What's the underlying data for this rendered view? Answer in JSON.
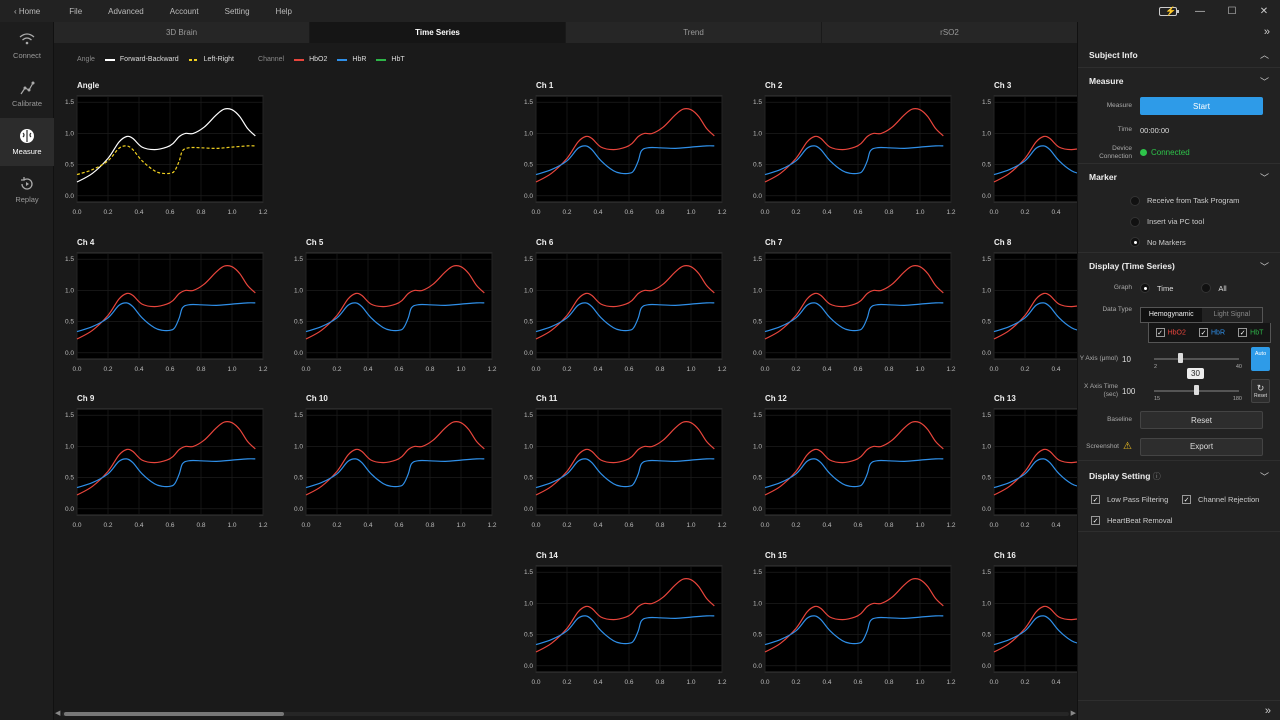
{
  "titlebar": {
    "home": "Home",
    "menu": [
      "File",
      "Advanced",
      "Account",
      "Setting",
      "Help"
    ]
  },
  "nav": [
    {
      "label": "Connect",
      "icon": "wifi-icon"
    },
    {
      "label": "Calibrate",
      "icon": "calibrate-icon"
    },
    {
      "label": "Measure",
      "icon": "brain-icon",
      "active": true
    },
    {
      "label": "Replay",
      "icon": "replay-icon"
    }
  ],
  "tabs": [
    {
      "label": "3D Brain"
    },
    {
      "label": "Time Series",
      "active": true
    },
    {
      "label": "Trend"
    },
    {
      "label": "rSO2"
    }
  ],
  "legend": {
    "angle_title": "Angle",
    "angle_items": [
      "Forward-Backward",
      "Left-Right"
    ],
    "channel_title": "Channel",
    "channel_items": [
      "HbO2",
      "HbR",
      "HbT"
    ]
  },
  "colors": {
    "hbo2": "#e8453c",
    "hbr": "#2f8fe8",
    "hbt": "#2db548",
    "forward_backward": "#ffffff",
    "left_right": "#f0d020",
    "accent": "#2e9be8",
    "connected": "#2ec44a"
  },
  "chart_data": {
    "type": "line",
    "x_ticks": [
      "0.0",
      "0.2",
      "0.4",
      "0.6",
      "0.8",
      "1.0",
      "1.2"
    ],
    "y_ticks": [
      "0.0",
      "0.5",
      "1.0",
      "1.5"
    ],
    "xlim": [
      0,
      1.2
    ],
    "ylim": [
      -0.1,
      1.6
    ],
    "charts": [
      {
        "title": "Angle",
        "series": [
          {
            "name": "Forward-Backward",
            "color": "#ffffff",
            "dashed": false,
            "x": [
              0.0,
              0.1,
              0.2,
              0.27,
              0.32,
              0.36,
              0.42,
              0.5,
              0.58,
              0.62,
              0.66,
              0.7,
              0.75,
              0.82,
              0.9,
              0.95,
              1.0,
              1.05,
              1.1,
              1.15
            ],
            "y": [
              0.22,
              0.36,
              0.6,
              0.86,
              0.95,
              0.92,
              0.78,
              0.74,
              0.78,
              0.84,
              0.95,
              1.0,
              1.0,
              1.1,
              1.3,
              1.39,
              1.38,
              1.27,
              1.08,
              0.96
            ]
          },
          {
            "name": "Left-Right",
            "color": "#f0d020",
            "dashed": true,
            "x": [
              0.0,
              0.1,
              0.2,
              0.27,
              0.32,
              0.36,
              0.42,
              0.5,
              0.55,
              0.6,
              0.63,
              0.66,
              0.68,
              0.72,
              0.8,
              0.9,
              1.0,
              1.1,
              1.15
            ],
            "y": [
              0.34,
              0.42,
              0.56,
              0.76,
              0.8,
              0.74,
              0.56,
              0.4,
              0.36,
              0.36,
              0.4,
              0.56,
              0.72,
              0.77,
              0.77,
              0.76,
              0.78,
              0.8,
              0.8
            ]
          }
        ]
      },
      {
        "title": "Ch 1",
        "preset": "channel"
      },
      {
        "title": "Ch 2",
        "preset": "channel"
      },
      {
        "title": "Ch 3",
        "preset": "channel"
      },
      {
        "title": "Ch 4",
        "preset": "channel"
      },
      {
        "title": "Ch 5",
        "preset": "channel"
      },
      {
        "title": "Ch 6",
        "preset": "channel"
      },
      {
        "title": "Ch 7",
        "preset": "channel"
      },
      {
        "title": "Ch 8",
        "preset": "channel"
      },
      {
        "title": "Ch 9",
        "preset": "channel"
      },
      {
        "title": "Ch 10",
        "preset": "channel"
      },
      {
        "title": "Ch 11",
        "preset": "channel"
      },
      {
        "title": "Ch 12",
        "preset": "channel"
      },
      {
        "title": "Ch 13",
        "preset": "channel"
      },
      {
        "title": "Ch 14",
        "preset": "channel"
      },
      {
        "title": "Ch 15",
        "preset": "channel"
      },
      {
        "title": "Ch 16",
        "preset": "channel"
      }
    ],
    "channel_series": [
      {
        "name": "HbO2",
        "color": "#e8453c",
        "x": [
          0.0,
          0.1,
          0.2,
          0.27,
          0.32,
          0.36,
          0.42,
          0.5,
          0.58,
          0.62,
          0.66,
          0.7,
          0.75,
          0.82,
          0.9,
          0.95,
          1.0,
          1.05,
          1.1,
          1.15
        ],
        "y": [
          0.22,
          0.36,
          0.6,
          0.86,
          0.95,
          0.92,
          0.78,
          0.74,
          0.78,
          0.84,
          0.95,
          1.0,
          1.0,
          1.1,
          1.3,
          1.39,
          1.38,
          1.27,
          1.08,
          0.96
        ]
      },
      {
        "name": "HbR",
        "color": "#2f8fe8",
        "x": [
          0.0,
          0.1,
          0.2,
          0.27,
          0.32,
          0.36,
          0.42,
          0.5,
          0.55,
          0.6,
          0.63,
          0.66,
          0.68,
          0.72,
          0.8,
          0.9,
          1.0,
          1.1,
          1.15
        ],
        "y": [
          0.34,
          0.42,
          0.56,
          0.76,
          0.8,
          0.74,
          0.56,
          0.4,
          0.36,
          0.36,
          0.4,
          0.56,
          0.72,
          0.77,
          0.77,
          0.76,
          0.78,
          0.8,
          0.8
        ]
      }
    ]
  },
  "panel": {
    "subject_info": "Subject Info",
    "measure": {
      "title": "Measure",
      "measure_label": "Measure",
      "start_button": "Start",
      "time_label": "Time",
      "time_value": "00:00:00",
      "device_label": "Device Connection",
      "device_status": "Connected"
    },
    "marker": {
      "title": "Marker",
      "options": [
        {
          "label": "Receive from Task Program",
          "selected": false
        },
        {
          "label": "Insert via PC tool",
          "selected": false
        },
        {
          "label": "No Markers",
          "selected": true
        }
      ]
    },
    "display_ts": {
      "title": "Display (Time Series)",
      "graph_label": "Graph",
      "graph_options": [
        {
          "label": "Time",
          "selected": true
        },
        {
          "label": "All",
          "selected": false
        }
      ],
      "datatype_label": "Data Type",
      "datatype_tabs": [
        {
          "label": "Hemogynamic",
          "active": true
        },
        {
          "label": "Light Signal",
          "active": false
        }
      ],
      "datatype_checks": [
        "HbO2",
        "HbR",
        "HbT"
      ],
      "yaxis_label": "Y Axis (μmol)",
      "yaxis_value": "10",
      "yaxis_min": "2",
      "yaxis_max": "40",
      "yaxis_level": 0.3,
      "auto_label": "Auto",
      "xaxis_label": "X Axis Time (sec)",
      "xaxis_value": "100",
      "xaxis_tooltip": "30",
      "xaxis_min": "15",
      "xaxis_max": "180",
      "xaxis_level": 0.5,
      "reset_small": "Reset",
      "baseline_label": "Baseline",
      "baseline_button": "Reset",
      "screenshot_label": "Screenshot",
      "export_button": "Export"
    },
    "display_setting": {
      "title": "Display Setting",
      "checks": [
        "Low Pass Filtering",
        "Channel Rejection",
        "HeartBeat Removal"
      ]
    }
  }
}
